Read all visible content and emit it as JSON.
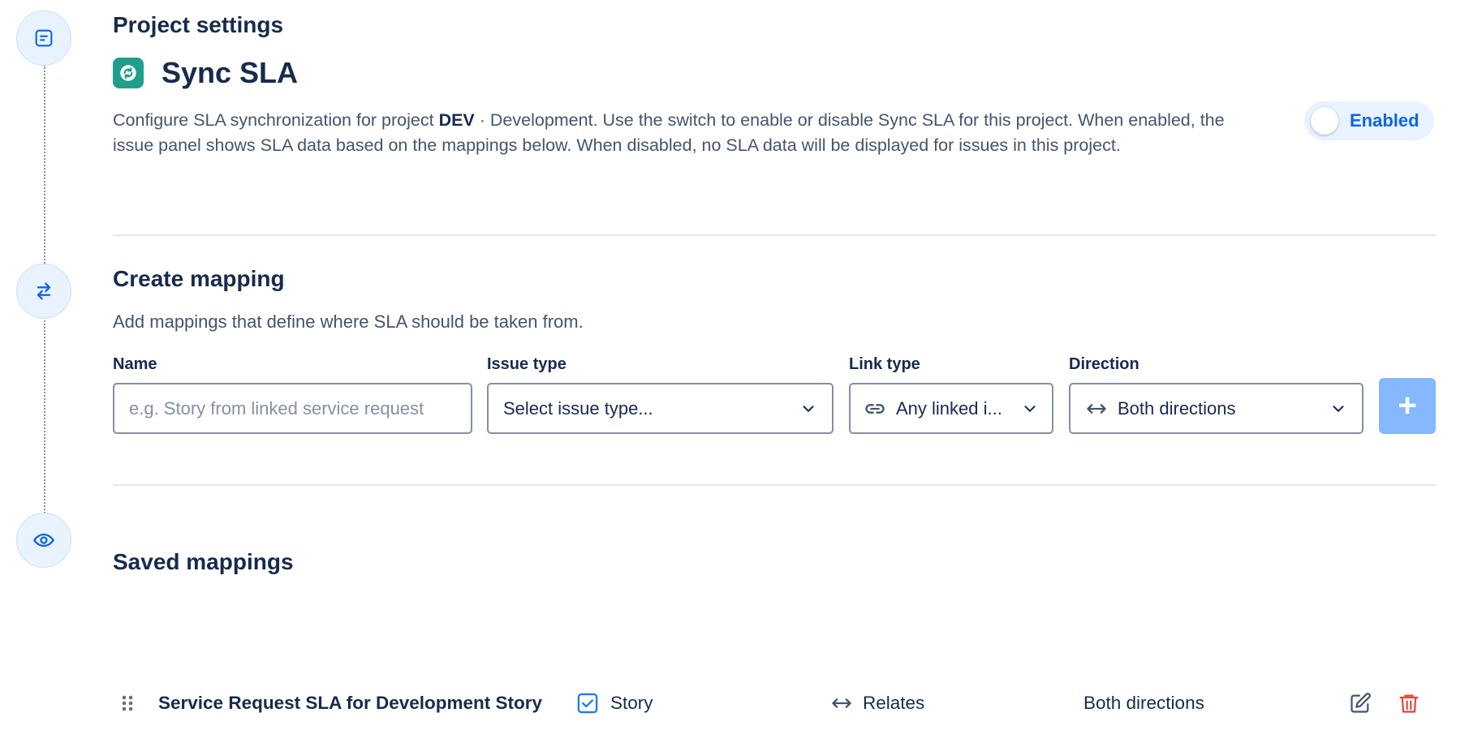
{
  "settings": {
    "section_title": "Project settings",
    "app_title": "Sync SLA",
    "desc_before": "Configure SLA synchronization for project ",
    "project_key": "DEV",
    "desc_after": " · Development. Use the switch to enable or disable Sync SLA for this project. When enabled, the issue panel shows SLA data based on the mappings below. When disabled, no SLA data will be displayed for issues in this project.",
    "toggle_label": "Enabled",
    "toggle_on": false
  },
  "create": {
    "title": "Create mapping",
    "description": "Add mappings that define where SLA should be taken from.",
    "name_label": "Name",
    "name_placeholder": "e.g. Story from linked service request",
    "issue_type_label": "Issue type",
    "issue_type_value": "Select issue type...",
    "link_type_label": "Link type",
    "link_type_value": "Any linked i...",
    "direction_label": "Direction",
    "direction_value": "Both directions",
    "add_label": "+"
  },
  "saved": {
    "title": "Saved mappings",
    "rows": [
      {
        "name": "Service Request SLA for Development Story",
        "issue_type": "Story",
        "link_type": "Relates",
        "direction": "Both directions"
      }
    ]
  },
  "colors": {
    "accent": "#0c66e4",
    "logo": "#1f9e8a",
    "add_button": "#85b8ff",
    "delete": "#e2483d"
  },
  "icons": {
    "settings_node": "document-icon",
    "create_node": "swap-arrows-icon",
    "saved_node": "eye-icon"
  }
}
